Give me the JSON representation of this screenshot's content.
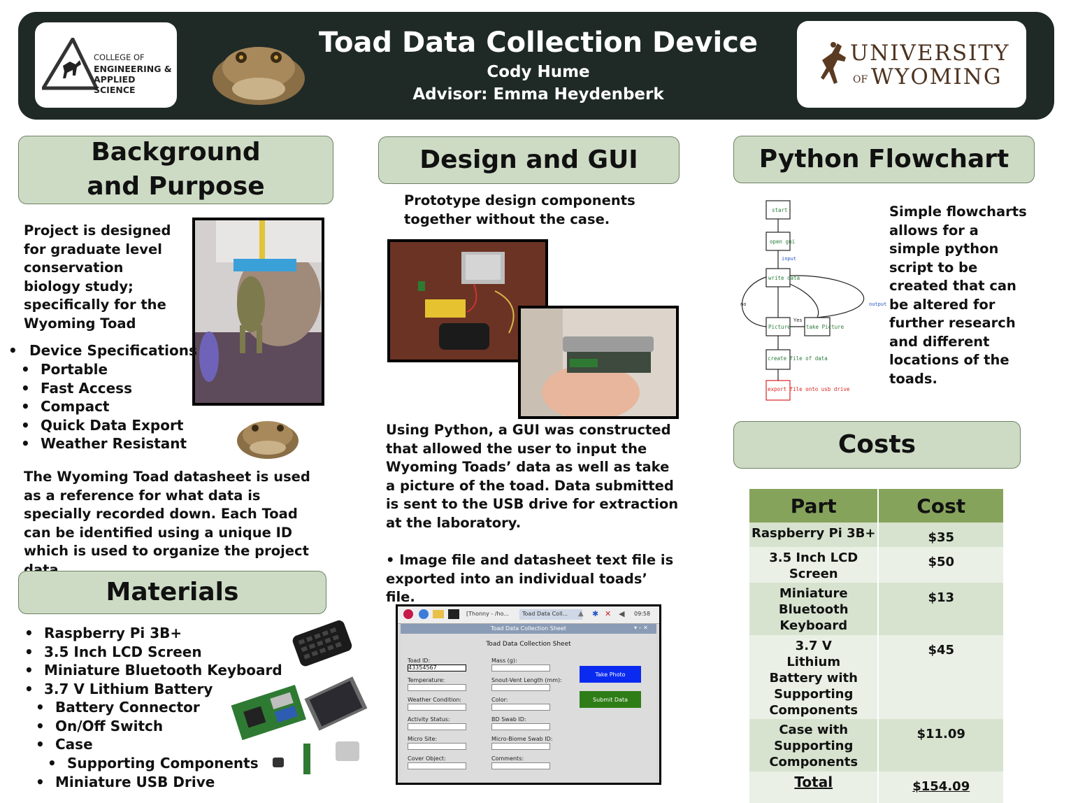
{
  "header": {
    "title": "Toad Data Collection Device",
    "author": "Cody Hume",
    "advisor": "Advisor: Emma Heydenberk",
    "left_logo": {
      "line1": "COLLEGE OF",
      "line2": "ENGINEERING &",
      "line3": "APPLIED SCIENCE"
    },
    "right_logo": {
      "line1": "UNIVERSITY",
      "line2_of": "OF",
      "line2": "WYOMING"
    }
  },
  "background": {
    "heading": "Background and Purpose",
    "intro": "Project is designed for graduate level conservation biology study; specifically for the Wyoming Toad",
    "spec_title": "Device Specifications",
    "specs": [
      "Portable",
      "Fast Access",
      "Compact",
      "Quick Data Export",
      "Weather Resistant"
    ],
    "datasheet_text": "The Wyoming Toad datasheet is used as a reference for what data is specially recorded down. Each Toad can be identified using a unique ID which is used to organize the project data."
  },
  "materials": {
    "heading": "Materials",
    "items": [
      "Raspberry Pi 3B+",
      "3.5 Inch LCD Screen",
      "Miniature Bluetooth Keyboard",
      "3.7 V Lithium Battery"
    ],
    "sub_items": [
      "Battery Connector",
      "On/Off Switch",
      "Case"
    ],
    "sub_sub_items": [
      "Supporting Components"
    ],
    "last_item": "Miniature USB Drive"
  },
  "design": {
    "heading": "Design and GUI",
    "caption": "Prototype design components together without the case.",
    "gui_text": "Using Python, a GUI was constructed that allowed the user to input the Wyoming Toads’ data as well as take a picture of the toad. Data submitted is sent to the USB drive for extraction at the laboratory.",
    "export_text": "• Image file and datasheet text file is exported into an individual toads’ file."
  },
  "gui_screenshot": {
    "taskbar_items": [
      "[Thonny - /ho...",
      "Toad Data Coll..."
    ],
    "clock": "09:58",
    "window_title": "Toad Data Collection Sheet",
    "sheet_title": "Toad Data Collection Sheet",
    "left_fields": [
      "Toad ID:",
      "Temperature:",
      "Weather Condition:",
      "Activity Status:",
      "Micro Site:",
      "Cover Object:"
    ],
    "right_fields": [
      "Mass (g):",
      "Snout-Vent Length (mm):",
      "Color:",
      "BD Swab ID:",
      "Micro-Biome Swab ID:",
      "Comments:"
    ],
    "toad_id_value": "43354567",
    "take_photo": "Take Photo",
    "submit": "Submit Data",
    "colors": {
      "take_photo": "#0b2af0",
      "submit": "#2f7d16"
    }
  },
  "flowchart": {
    "heading": "Python Flowchart",
    "description": "Simple flowcharts allows for a simple python script to be created that can be altered for further research and different locations of the toads.",
    "nodes": [
      "start",
      "open gui",
      "write data",
      "Picture",
      "take Picture",
      "create file of data",
      "export file onto usb drive"
    ],
    "edge_labels": [
      "input",
      "no",
      "Yes",
      "output"
    ]
  },
  "costs": {
    "heading": "Costs",
    "col_part": "Part",
    "col_cost": "Cost",
    "rows": [
      {
        "part": "Raspberry Pi 3B+",
        "cost": "$35"
      },
      {
        "part": "3.5 Inch LCD Screen",
        "cost": "$50"
      },
      {
        "part": "Miniature Bluetooth Keyboard",
        "cost": "$13"
      },
      {
        "part": "3.7 V Lithium Battery with Supporting Components",
        "cost": "$45"
      },
      {
        "part": "Case with Supporting Components",
        "cost": "$11.09"
      }
    ],
    "total_label": "Total",
    "total_value": "$154.09"
  }
}
